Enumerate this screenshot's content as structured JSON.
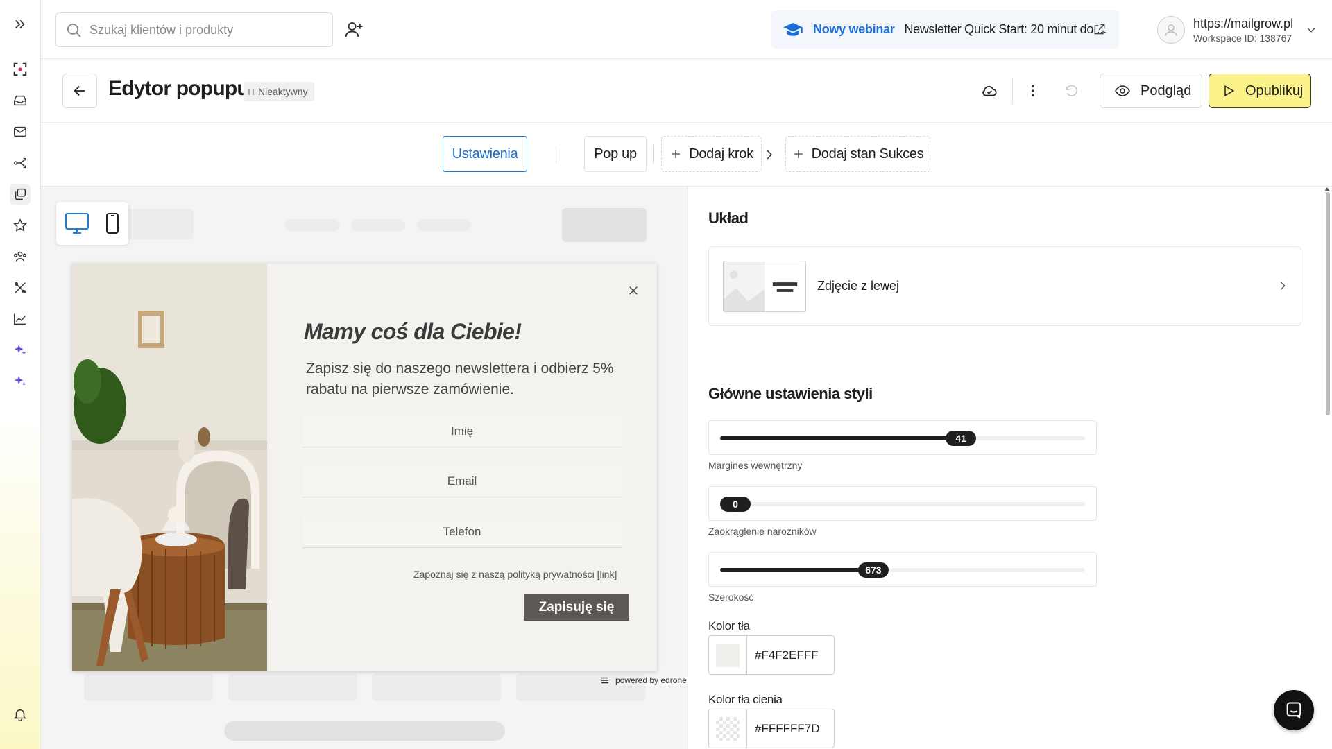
{
  "search": {
    "placeholder": "Szukaj klientów i produkty"
  },
  "webinar": {
    "badge": "Nowy webinar",
    "title": "Newsletter Quick Start: 20 minut do ..."
  },
  "account": {
    "url": "https://mailgrow.pl",
    "workspace": "Workspace ID: 138767"
  },
  "editor": {
    "title": "Edytor popupu",
    "status": "Nieaktywny",
    "preview_label": "Podgląd",
    "publish_label": "Opublikuj"
  },
  "steps": {
    "settings": "Ustawienia",
    "popup": "Pop up",
    "add_step": "Dodaj krok",
    "add_success": "Dodaj stan Sukces"
  },
  "popup": {
    "heading": "Mamy coś dla Ciebie!",
    "subtitle": "Zapisz się do naszego newslettera i odbierz 5% rabatu na pierwsze zamówienie.",
    "fields": [
      "Imię",
      "Email",
      "Telefon"
    ],
    "privacy": "Zapoznaj się z naszą polityką prywatności [link]",
    "submit": "Zapisuję się",
    "powered": "powered by edrone"
  },
  "panel": {
    "layout_title": "Układ",
    "layout_option": "Zdjęcie z lewej",
    "styles_title": "Główne ustawienia styli",
    "sliders": [
      {
        "label": "Margines wewnętrzny",
        "value": "41",
        "fraction": 0.66
      },
      {
        "label": "Zaokrąglenie narożników",
        "value": "0",
        "fraction": 0.0
      },
      {
        "label": "Szerokość",
        "value": "673",
        "fraction": 0.42
      }
    ],
    "bg_color_label": "Kolor tła",
    "bg_color_value": "#F4F2EFFF",
    "shadow_color_label": "Kolor tła cienia",
    "shadow_color_value": "#FFFFFF7D"
  },
  "colors": {
    "accent": "#1b6fd6",
    "publish": "#fbf28a",
    "popup_bg": "#f4f2ef",
    "submit_bg": "#5e5855"
  }
}
